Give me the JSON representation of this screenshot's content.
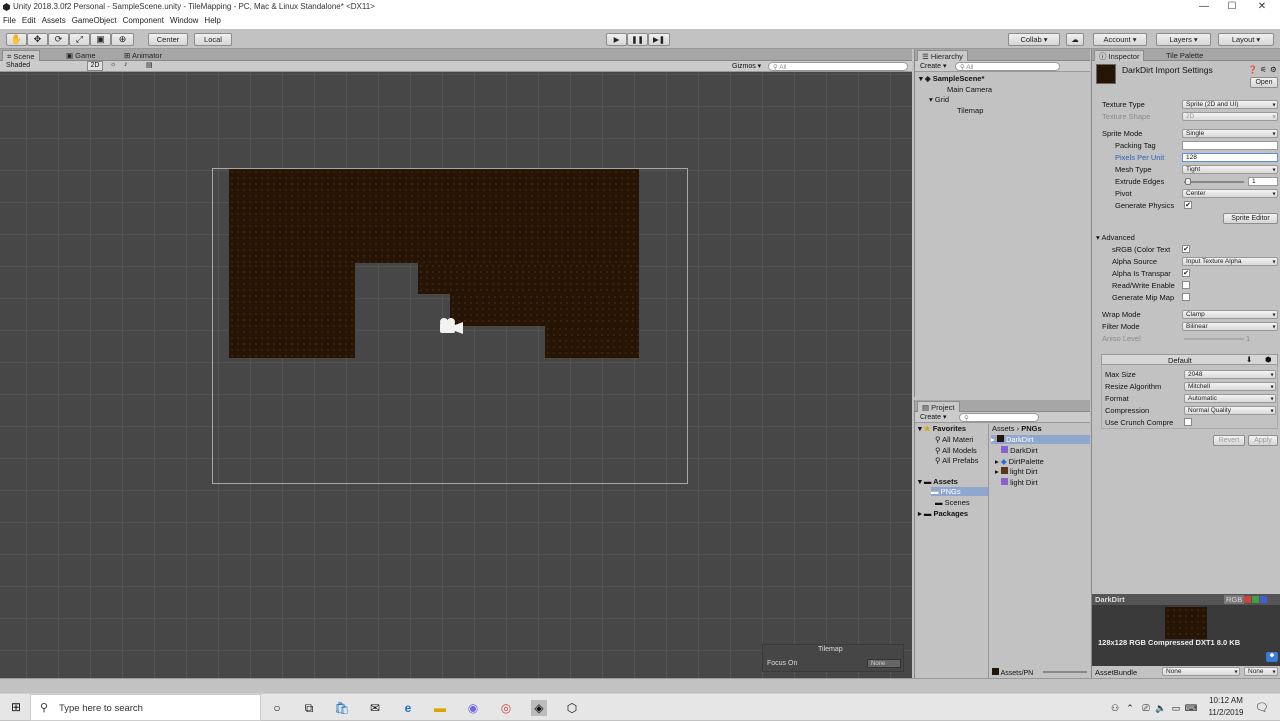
{
  "window": {
    "title": "Unity 2018.3.0f2 Personal - SampleScene.unity - TileMapping - PC, Mac & Linux Standalone* <DX11>",
    "minimize": "—",
    "maximize": "☐",
    "close": "✕"
  },
  "menu": [
    "File",
    "Edit",
    "Assets",
    "GameObject",
    "Component",
    "Window",
    "Help"
  ],
  "toolbar": {
    "pivot": "Center",
    "space": "Local",
    "collab": "Collab ▾",
    "account": "Account ▾",
    "layers": "Layers ▾",
    "layout": "Layout ▾",
    "play": "▶",
    "pause": "❚❚",
    "step": "▶❚"
  },
  "scene": {
    "tabs": [
      "Scene",
      "Game",
      "Animator"
    ],
    "shading": "Shaded",
    "mode2d": "2D",
    "gizmos": "Gizmos ▾",
    "search_placeholder": "All",
    "tilemap_overlay": "Tilemap",
    "focus_on": "Focus On",
    "focus_value": "None"
  },
  "hierarchy": {
    "tab": "Hierarchy",
    "create": "Create ▾",
    "search_placeholder": "All",
    "items": [
      "SampleScene*",
      "Main Camera",
      "Grid",
      "Tilemap"
    ]
  },
  "project": {
    "tab": "Project",
    "create": "Create ▾",
    "favorites": "Favorites",
    "fav_items": [
      "All Materi",
      "All Models",
      "All Prefabs"
    ],
    "assets": "Assets",
    "asset_folders": [
      "PNGs",
      "Scenes"
    ],
    "packages": "Packages",
    "breadcrumb": [
      "Assets",
      "PNGs"
    ],
    "files": [
      "DarkDirt",
      "DarkDirt",
      "DirtPalette",
      "light Dirt",
      "light Dirt"
    ],
    "footer": "Assets/PN"
  },
  "inspector": {
    "tabs": [
      "Inspector",
      "Tile Palette"
    ],
    "asset_title": "DarkDirt Import Settings",
    "open": "Open",
    "rows": [
      {
        "label": "Texture Type",
        "value": "Sprite (2D and UI)"
      },
      {
        "label": "Texture Shape",
        "value": "2D"
      },
      {
        "label": "Sprite Mode",
        "value": "Single"
      },
      {
        "label": "Packing Tag",
        "value": ""
      },
      {
        "label": "Pixels Per Unit",
        "value": "128"
      },
      {
        "label": "Mesh Type",
        "value": "Tight"
      },
      {
        "label": "Extrude Edges",
        "value": "1"
      },
      {
        "label": "Pivot",
        "value": "Center"
      },
      {
        "label": "Generate Physics",
        "value": "✔"
      }
    ],
    "sprite_editor": "Sprite Editor",
    "advanced": "Advanced",
    "adv_rows": [
      {
        "label": "sRGB (Color Text",
        "value": "✔"
      },
      {
        "label": "Alpha Source",
        "value": "Input Texture Alpha"
      },
      {
        "label": "Alpha Is Transpar",
        "value": "✔"
      },
      {
        "label": "Read/Write Enable",
        "value": ""
      },
      {
        "label": "Generate Mip Map",
        "value": ""
      }
    ],
    "wrap_mode": {
      "label": "Wrap Mode",
      "value": "Clamp"
    },
    "filter_mode": {
      "label": "Filter Mode",
      "value": "Bilinear"
    },
    "aniso": {
      "label": "Aniso Level",
      "value": "1"
    },
    "platform": "Default",
    "plat_rows": [
      {
        "label": "Max Size",
        "value": "2048"
      },
      {
        "label": "Resize Algorithm",
        "value": "Mitchell"
      },
      {
        "label": "Format",
        "value": "Automatic"
      },
      {
        "label": "Compression",
        "value": "Normal Quality"
      }
    ],
    "crunch": "Use Crunch Compre",
    "revert": "Revert",
    "apply": "Apply",
    "preview": {
      "name": "DarkDirt",
      "channels": "RGB",
      "info": "128x128  RGB Compressed DXT1   8.0 KB",
      "bundle": "AssetBundle",
      "bundle_value": "None",
      "bundle_variant": "None"
    }
  },
  "taskbar": {
    "search_placeholder": "Type here to search",
    "time": "10:12 AM",
    "date": "11/2/2019"
  },
  "colors": {
    "dirt": "#261405",
    "viewport": "#474747",
    "panel": "#c2c2c2"
  }
}
